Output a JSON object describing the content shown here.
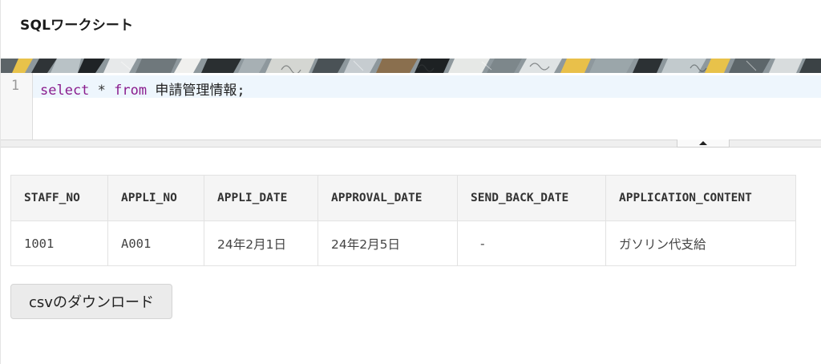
{
  "page": {
    "title": "SQLワークシート"
  },
  "editor": {
    "line_number": "1",
    "code": {
      "kw_select": "select",
      "star": " * ",
      "kw_from": "from",
      "table_name": " 申請管理情報;"
    }
  },
  "result": {
    "columns": [
      "STAFF_NO",
      "APPLI_NO",
      "APPLI_DATE",
      "APPROVAL_DATE",
      "SEND_BACK_DATE",
      "APPLICATION_CONTENT"
    ],
    "rows": [
      [
        "1001",
        "A001",
        "24年2月1日",
        "24年2月5日",
        "-",
        "ガソリン代支給"
      ]
    ]
  },
  "actions": {
    "download_label": "csvのダウンロード"
  },
  "colors": {
    "keyword": "#8a1d8e",
    "active_line": "#eef6fd",
    "header_bg": "#f5f5f5"
  }
}
